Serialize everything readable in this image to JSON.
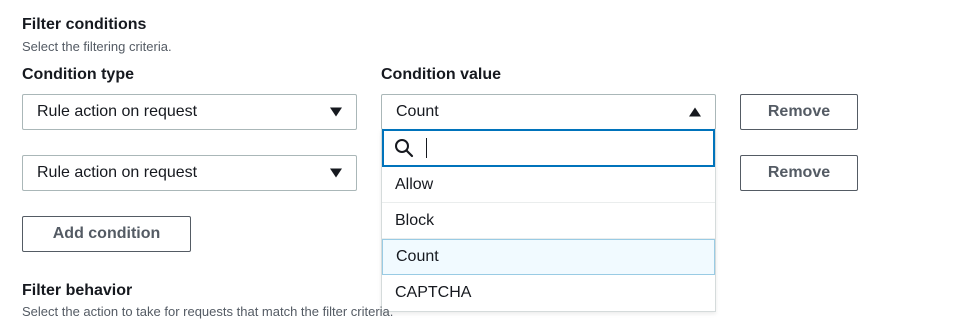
{
  "filter_conditions": {
    "title": "Filter conditions",
    "description": "Select the filtering criteria.",
    "condition_type_label": "Condition type",
    "condition_value_label": "Condition value",
    "rows": [
      {
        "type": "Rule action on request",
        "value": "Count",
        "remove_label": "Remove"
      },
      {
        "type": "Rule action on request",
        "value": "",
        "remove_label": "Remove"
      }
    ],
    "add_condition_label": "Add condition"
  },
  "value_dropdown": {
    "search_placeholder": "",
    "options": [
      "Allow",
      "Block",
      "Count",
      "CAPTCHA"
    ],
    "selected": "Count"
  },
  "filter_behavior": {
    "title": "Filter behavior",
    "description": "Select the action to take for requests that match the filter criteria."
  },
  "colors": {
    "focus_border": "#0073bb",
    "selected_bg": "#f1faff",
    "selected_border": "#99cbe4"
  }
}
